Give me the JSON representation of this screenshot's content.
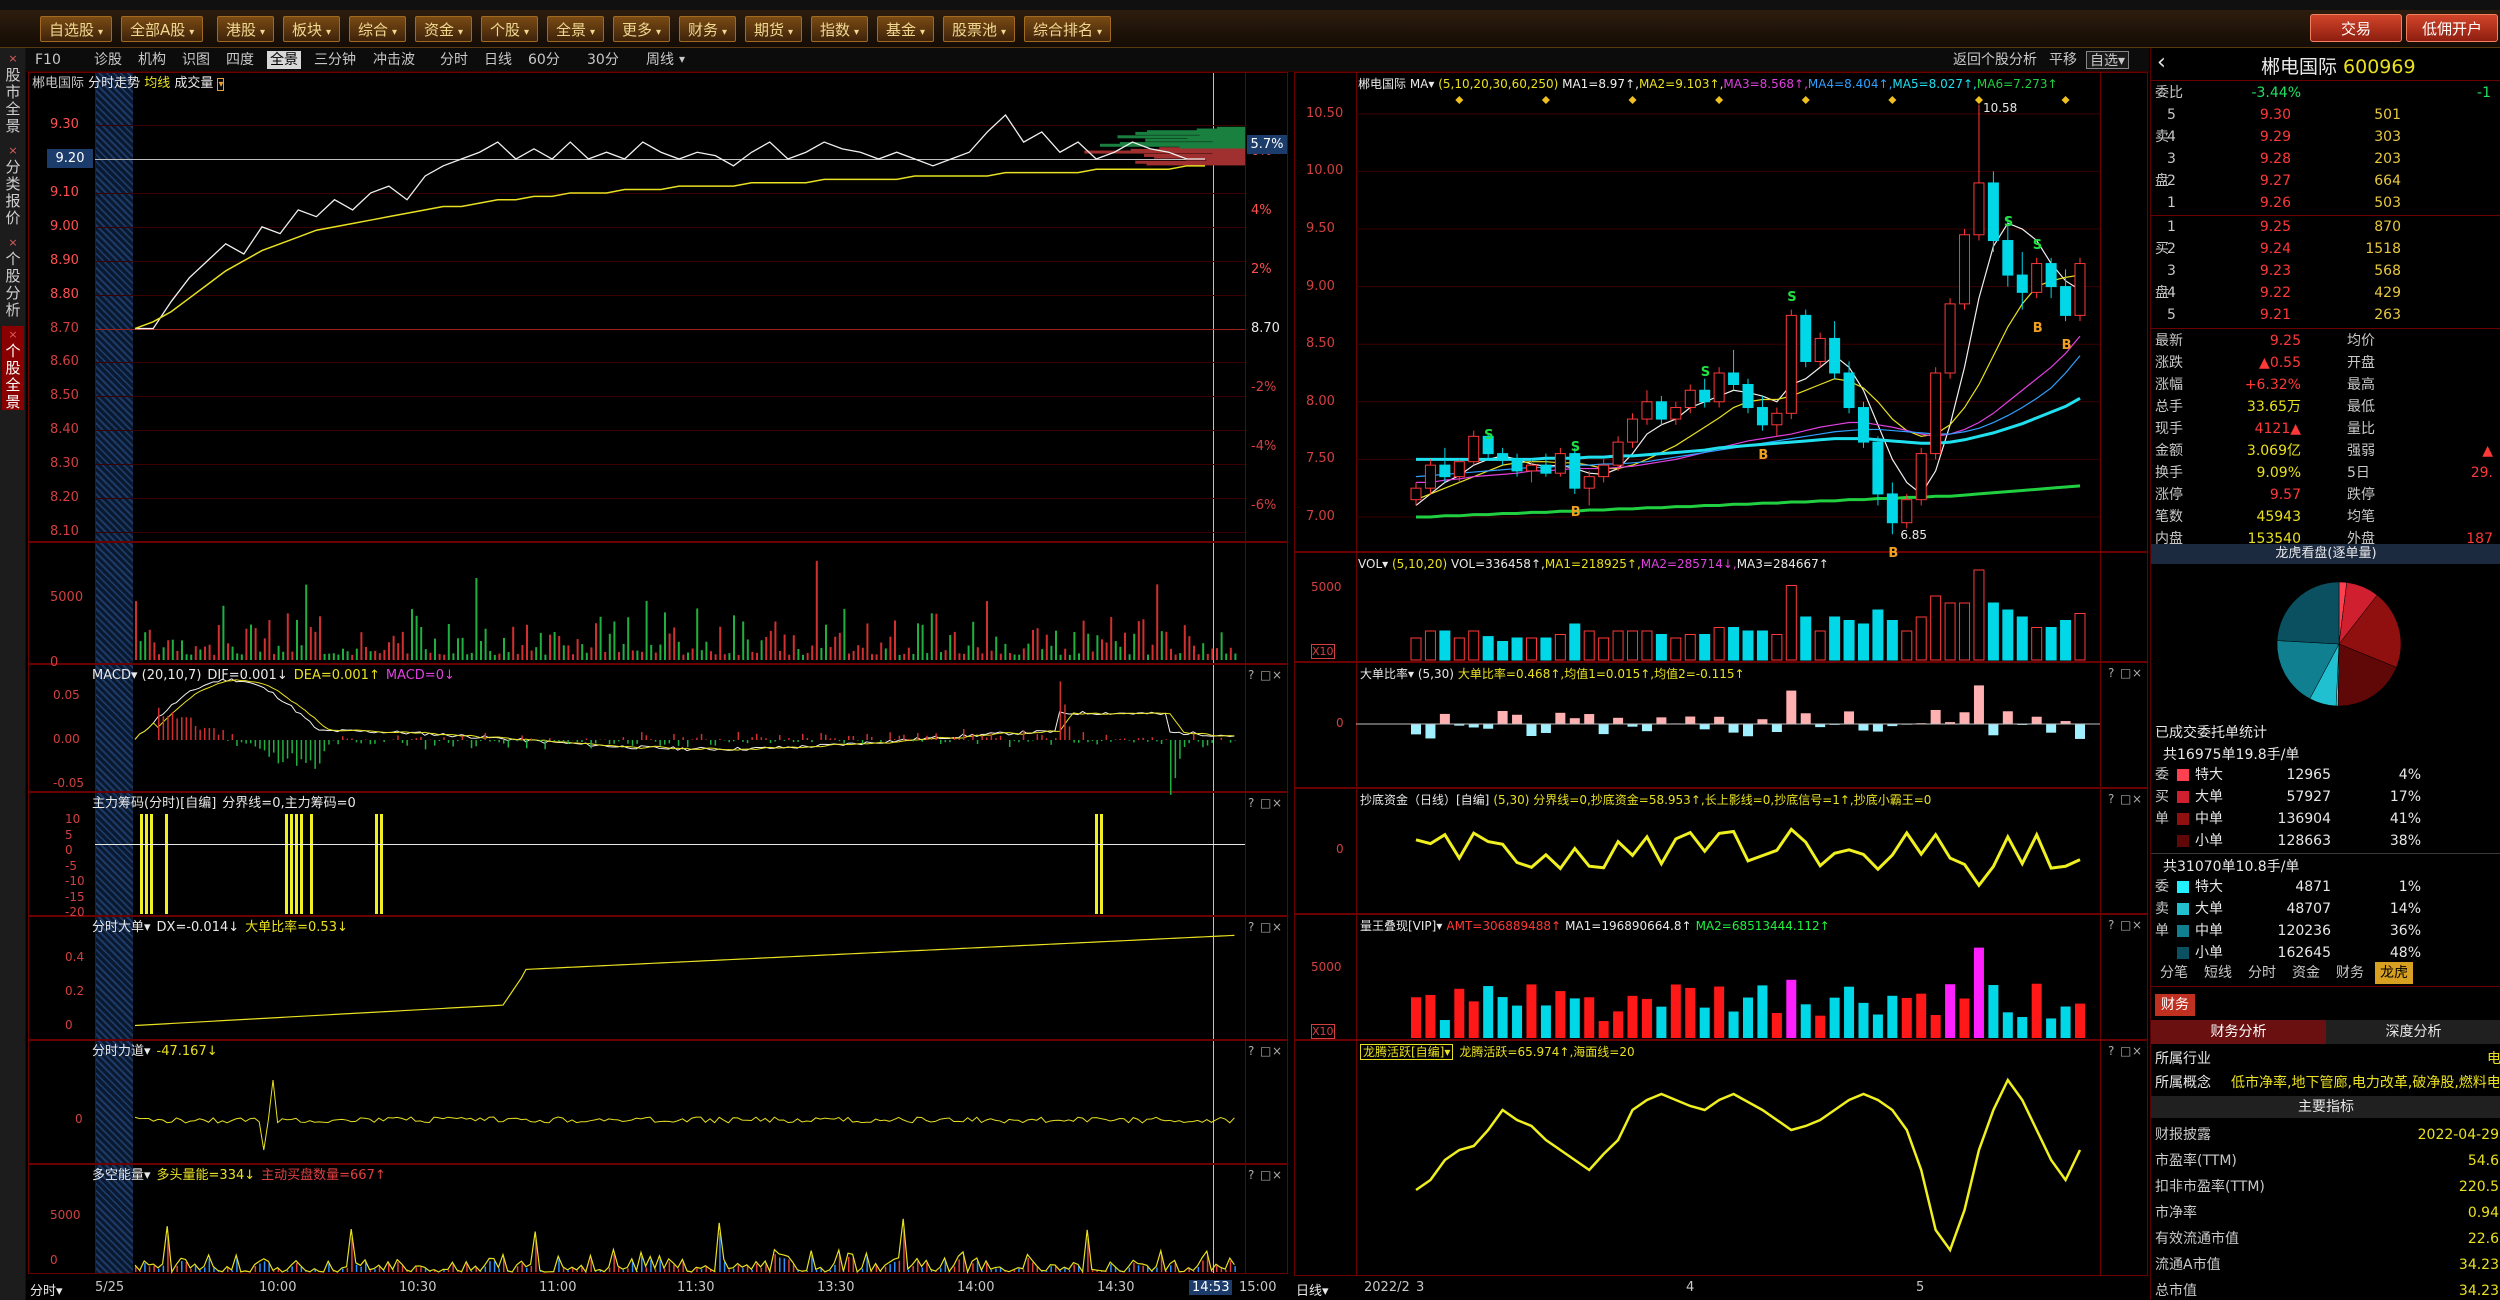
{
  "topmenu": {
    "items": [
      "自选股",
      "全部A股",
      "港股",
      "板块",
      "综合",
      "资金",
      "个股",
      "全景",
      "更多",
      "财务",
      "期货",
      "指数",
      "基金",
      "股票池",
      "综合排名"
    ],
    "trade_btn": "交易",
    "open_btn": "低佣开户"
  },
  "leftnav": [
    {
      "label": "股市全景",
      "active": false
    },
    {
      "label": "分类报价",
      "active": false
    },
    {
      "label": "个股分析",
      "active": false
    },
    {
      "label": "个股全景",
      "active": true
    }
  ],
  "toolbar": {
    "items": [
      "F10",
      "诊股",
      "机构",
      "识图",
      "四度",
      "全景",
      "三分钟",
      "冲击波",
      "分时",
      "日线",
      "60分",
      "30分",
      "周线"
    ],
    "active": "全景",
    "back_label": "返回个股分析",
    "flat_label": "平移",
    "selfsel_label": "自选"
  },
  "colors": {
    "up": "#ff3838",
    "down": "#00d8e8",
    "line_yellow": "#e8e020",
    "grid_red": "#6a0000",
    "label_white": "#e8e8e8"
  },
  "intraday": {
    "stock": "郴电国际",
    "title": "分时走势",
    "avg_label": "均线",
    "vol_label": "成交量",
    "prices": [
      "9.30",
      "9.20",
      "9.10",
      "9.00",
      "8.90",
      "8.80",
      "8.70",
      "8.60",
      "8.50",
      "8.40",
      "8.30",
      "8.20",
      "8.10"
    ],
    "pcts": [
      "6%",
      "4%",
      "2%",
      "-2%",
      "-4%",
      "-6%"
    ],
    "current_price": "9.20",
    "current_pct": "5.7%",
    "base_price": "8.70",
    "price_series": [
      8.7,
      8.7,
      8.78,
      8.85,
      8.9,
      8.95,
      8.92,
      9.0,
      8.98,
      9.05,
      9.03,
      9.08,
      9.05,
      9.1,
      9.12,
      9.08,
      9.15,
      9.18,
      9.2,
      9.22,
      9.25,
      9.2,
      9.23,
      9.2,
      9.25,
      9.2,
      9.22,
      9.2,
      9.25,
      9.22,
      9.2,
      9.22,
      9.21,
      9.18,
      9.22,
      9.25,
      9.2,
      9.22,
      9.25,
      9.23,
      9.22,
      9.2,
      9.22,
      9.2,
      9.18,
      9.2,
      9.22,
      9.28,
      9.33,
      9.25,
      9.28,
      9.22,
      9.25,
      9.2,
      9.22,
      9.25,
      9.23,
      9.22,
      9.2,
      9.2
    ],
    "avg_series": [
      8.7,
      8.72,
      8.75,
      8.79,
      8.83,
      8.87,
      8.9,
      8.93,
      8.95,
      8.97,
      8.99,
      9.0,
      9.01,
      9.02,
      9.03,
      9.04,
      9.05,
      9.06,
      9.06,
      9.07,
      9.08,
      9.08,
      9.09,
      9.09,
      9.1,
      9.1,
      9.1,
      9.11,
      9.11,
      9.11,
      9.12,
      9.12,
      9.12,
      9.12,
      9.13,
      9.13,
      9.13,
      9.13,
      9.14,
      9.14,
      9.14,
      9.14,
      9.14,
      9.15,
      9.15,
      9.15,
      9.15,
      9.15,
      9.16,
      9.16,
      9.16,
      9.16,
      9.16,
      9.17,
      9.17,
      9.17,
      9.17,
      9.17,
      9.18,
      9.18
    ],
    "price_range": [
      8.1,
      9.38
    ]
  },
  "vol_axis": [
    "5000",
    "0"
  ],
  "macd": {
    "title": "MACD",
    "params": "(20,10,7)",
    "dif": "DIF=0.001↓",
    "dea": "DEA=0.001↑",
    "macd": "MACD=0↓",
    "axis": [
      "0.05",
      "0.00",
      "-0.05"
    ]
  },
  "zljc": {
    "title": "主力筹码(分时)",
    "tag": "[自编]",
    "text": "分界线=0,主力筹码=0",
    "axis": [
      "10",
      "5",
      "0",
      "-5",
      "-10",
      "-15",
      "-20"
    ]
  },
  "fsdd": {
    "title": "分时大单",
    "text1": "DX=-0.014↓",
    "text2": "大单比率=0.53↓",
    "axis": [
      "0.4",
      "0.2",
      "0"
    ]
  },
  "fsld": {
    "title": "分时力道",
    "text1": "-47.167↓",
    "axis": [
      "0"
    ]
  },
  "dknl": {
    "title": "多空能量",
    "text1": "多头量能=334↓",
    "text2": "主动买盘数量=667↑",
    "axis": [
      "5000",
      "0"
    ]
  },
  "time_axis": {
    "label": "分时",
    "items": [
      "5/25",
      "10:00",
      "10:30",
      "11:00",
      "11:30",
      "13:30",
      "14:00",
      "14:30",
      "14:53",
      "15:00"
    ]
  },
  "kline": {
    "stock": "郴电国际",
    "ma_label": "MA",
    "params": "(5,10,20,30,60,250)",
    "ma1": "MA1=8.97↑",
    "ma2": "MA2=9.103↑",
    "ma3": "MA3=8.568↑",
    "ma4": "MA4=8.404↑",
    "ma5": "MA5=8.027↑",
    "ma6": "MA6=7.273↑",
    "axis": [
      "10.50",
      "10.00",
      "9.50",
      "9.00",
      "8.50",
      "8.00",
      "7.50",
      "7.00"
    ],
    "high_label": "10.58",
    "low_label": "6.85",
    "range": [
      6.8,
      10.62
    ],
    "ohlc": [
      [
        7.15,
        7.3,
        7.1,
        7.25
      ],
      [
        7.25,
        7.5,
        7.2,
        7.45
      ],
      [
        7.45,
        7.6,
        7.3,
        7.35
      ],
      [
        7.35,
        7.5,
        7.3,
        7.48
      ],
      [
        7.48,
        7.75,
        7.45,
        7.7
      ],
      [
        7.7,
        7.72,
        7.5,
        7.55
      ],
      [
        7.55,
        7.6,
        7.45,
        7.5
      ],
      [
        7.5,
        7.55,
        7.35,
        7.4
      ],
      [
        7.4,
        7.5,
        7.3,
        7.45
      ],
      [
        7.45,
        7.55,
        7.35,
        7.38
      ],
      [
        7.38,
        7.6,
        7.35,
        7.55
      ],
      [
        7.55,
        7.6,
        7.2,
        7.25
      ],
      [
        7.25,
        7.4,
        7.1,
        7.35
      ],
      [
        7.35,
        7.5,
        7.3,
        7.45
      ],
      [
        7.45,
        7.7,
        7.4,
        7.65
      ],
      [
        7.65,
        7.9,
        7.6,
        7.85
      ],
      [
        7.85,
        8.1,
        7.8,
        8.0
      ],
      [
        8.0,
        8.05,
        7.8,
        7.85
      ],
      [
        7.85,
        8.0,
        7.8,
        7.95
      ],
      [
        7.95,
        8.15,
        7.9,
        8.1
      ],
      [
        8.1,
        8.2,
        7.95,
        8.0
      ],
      [
        8.0,
        8.3,
        7.95,
        8.25
      ],
      [
        8.25,
        8.45,
        8.1,
        8.15
      ],
      [
        8.15,
        8.2,
        7.9,
        7.95
      ],
      [
        7.95,
        8.05,
        7.75,
        7.8
      ],
      [
        7.8,
        7.95,
        7.7,
        7.9
      ],
      [
        7.9,
        8.8,
        7.85,
        8.75
      ],
      [
        8.75,
        8.8,
        8.3,
        8.35
      ],
      [
        8.35,
        8.6,
        8.3,
        8.55
      ],
      [
        8.55,
        8.7,
        8.2,
        8.25
      ],
      [
        8.25,
        8.35,
        7.9,
        7.95
      ],
      [
        7.95,
        8.0,
        7.6,
        7.65
      ],
      [
        7.65,
        7.7,
        7.1,
        7.2
      ],
      [
        7.2,
        7.3,
        6.85,
        6.95
      ],
      [
        6.95,
        7.2,
        6.9,
        7.15
      ],
      [
        7.15,
        7.6,
        7.1,
        7.55
      ],
      [
        7.55,
        8.3,
        7.5,
        8.25
      ],
      [
        8.25,
        8.9,
        8.2,
        8.85
      ],
      [
        8.85,
        9.5,
        8.8,
        9.45
      ],
      [
        9.45,
        10.58,
        9.4,
        9.9
      ],
      [
        9.9,
        10.0,
        9.3,
        9.4
      ],
      [
        9.4,
        9.6,
        9.0,
        9.1
      ],
      [
        9.1,
        9.3,
        8.8,
        8.95
      ],
      [
        8.95,
        9.25,
        8.9,
        9.2
      ],
      [
        9.2,
        9.25,
        8.9,
        9.0
      ],
      [
        9.0,
        9.15,
        8.7,
        8.75
      ],
      [
        8.75,
        9.25,
        8.7,
        9.2
      ]
    ],
    "ma_series": [
      {
        "color": "#f0f0f0",
        "values": [
          7.1,
          7.2,
          7.3,
          7.36,
          7.45,
          7.5,
          7.53,
          7.5,
          7.46,
          7.44,
          7.45,
          7.42,
          7.38,
          7.37,
          7.42,
          7.55,
          7.72,
          7.8,
          7.85,
          7.95,
          8.0,
          8.05,
          8.1,
          8.08,
          8.05,
          8.0,
          8.15,
          8.2,
          8.3,
          8.4,
          8.3,
          8.1,
          7.8,
          7.5,
          7.3,
          7.2,
          7.4,
          7.8,
          8.3,
          8.9,
          9.35,
          9.55,
          9.5,
          9.4,
          9.2,
          9.05,
          8.97
        ]
      },
      {
        "color": "#e8e020",
        "values": [
          7.15,
          7.2,
          7.25,
          7.3,
          7.35,
          7.4,
          7.45,
          7.47,
          7.48,
          7.48,
          7.47,
          7.47,
          7.45,
          7.42,
          7.42,
          7.45,
          7.5,
          7.56,
          7.62,
          7.7,
          7.78,
          7.86,
          7.95,
          8.0,
          8.02,
          8.02,
          8.05,
          8.1,
          8.15,
          8.2,
          8.18,
          8.12,
          8.0,
          7.85,
          7.75,
          7.7,
          7.72,
          7.8,
          7.95,
          8.15,
          8.4,
          8.65,
          8.85,
          9.0,
          9.05,
          9.08,
          9.1
        ]
      },
      {
        "color": "#e040e0",
        "values": [
          7.3,
          7.3,
          7.32,
          7.33,
          7.35,
          7.36,
          7.37,
          7.38,
          7.4,
          7.4,
          7.41,
          7.42,
          7.42,
          7.42,
          7.43,
          7.44,
          7.46,
          7.48,
          7.5,
          7.53,
          7.56,
          7.6,
          7.63,
          7.66,
          7.68,
          7.7,
          7.72,
          7.75,
          7.78,
          7.8,
          7.82,
          7.82,
          7.8,
          7.78,
          7.75,
          7.72,
          7.7,
          7.72,
          7.76,
          7.82,
          7.9,
          8.0,
          8.1,
          8.2,
          8.3,
          8.42,
          8.57
        ]
      },
      {
        "color": "#30a0ff",
        "values": [
          7.35,
          7.36,
          7.37,
          7.38,
          7.39,
          7.4,
          7.41,
          7.42,
          7.43,
          7.43,
          7.44,
          7.45,
          7.45,
          7.46,
          7.46,
          7.47,
          7.48,
          7.5,
          7.52,
          7.54,
          7.56,
          7.58,
          7.6,
          7.62,
          7.64,
          7.66,
          7.68,
          7.7,
          7.72,
          7.74,
          7.75,
          7.76,
          7.76,
          7.75,
          7.74,
          7.73,
          7.72,
          7.72,
          7.74,
          7.77,
          7.82,
          7.88,
          7.95,
          8.03,
          8.12,
          8.25,
          8.4
        ]
      },
      {
        "color": "#20e0f0",
        "values": [
          7.5,
          7.5,
          7.5,
          7.5,
          7.5,
          7.5,
          7.5,
          7.5,
          7.5,
          7.51,
          7.51,
          7.51,
          7.52,
          7.52,
          7.53,
          7.53,
          7.54,
          7.55,
          7.56,
          7.57,
          7.58,
          7.6,
          7.61,
          7.62,
          7.63,
          7.64,
          7.65,
          7.66,
          7.67,
          7.68,
          7.68,
          7.68,
          7.67,
          7.66,
          7.65,
          7.64,
          7.64,
          7.65,
          7.67,
          7.7,
          7.73,
          7.77,
          7.81,
          7.86,
          7.91,
          7.96,
          8.03
        ]
      },
      {
        "color": "#20d040",
        "values": [
          7.0,
          7.0,
          7.01,
          7.01,
          7.02,
          7.02,
          7.03,
          7.03,
          7.04,
          7.04,
          7.05,
          7.05,
          7.06,
          7.06,
          7.07,
          7.07,
          7.08,
          7.08,
          7.09,
          7.09,
          7.1,
          7.1,
          7.11,
          7.11,
          7.12,
          7.12,
          7.13,
          7.13,
          7.14,
          7.14,
          7.15,
          7.15,
          7.16,
          7.16,
          7.17,
          7.17,
          7.18,
          7.18,
          7.19,
          7.2,
          7.21,
          7.22,
          7.23,
          7.24,
          7.25,
          7.26,
          7.27
        ]
      }
    ]
  },
  "kvol": {
    "title": "VOL",
    "params": "(5,10,20)",
    "vol": "VOL=336458↑",
    "ma1": "MA1=218925↑",
    "ma2": "MA2=285714↓",
    "ma3": "MA3=284667↑",
    "axis": [
      "5000",
      "0"
    ],
    "unit_label": "X10"
  },
  "ddbl": {
    "title": "大单比率",
    "params": "(5,30)",
    "text": "大单比率=0.468↑,均值1=0.015↑,均值2=-0.115↑",
    "axis": [
      "0"
    ]
  },
  "cdzj": {
    "title": "抄底资金（日线）",
    "tag": "[自编]",
    "params": "(5,30)",
    "text": "分界线=0,抄底资金=58.953↑,长上影线=0,抄底信号=1↑,抄底小霸王=0",
    "axis": [
      "0"
    ]
  },
  "lwdx": {
    "title": "量王叠现[VIP]",
    "amt": "AMT=306889488↑",
    "ma1": "MA1=196890664.8↑",
    "ma2": "MA2=68513444.112↑",
    "axis": [
      "5000",
      "0"
    ],
    "unit_label": "X10"
  },
  "ltyh": {
    "title": "龙腾活跃[自编]",
    "text1": "龙腾活跃=65.974↑",
    "text2": "海面线=20"
  },
  "k_time_axis": {
    "label": "日线",
    "items": [
      "2022/2",
      "3",
      "4",
      "5"
    ]
  },
  "quote": {
    "name": "郴电国际",
    "code": "600969",
    "ratio_label": "委比",
    "ratio": "-3.44%",
    "ratio_right": "-1",
    "asks": [
      {
        "lvl": "5",
        "price": "9.30",
        "vol": "501"
      },
      {
        "lvl": "4",
        "price": "9.29",
        "vol": "303"
      },
      {
        "lvl": "3",
        "price": "9.28",
        "vol": "203"
      },
      {
        "lvl": "2",
        "price": "9.27",
        "vol": "664"
      },
      {
        "lvl": "1",
        "price": "9.26",
        "vol": "503"
      }
    ],
    "bids": [
      {
        "lvl": "1",
        "price": "9.25",
        "vol": "870"
      },
      {
        "lvl": "2",
        "price": "9.24",
        "vol": "1518"
      },
      {
        "lvl": "3",
        "price": "9.23",
        "vol": "568"
      },
      {
        "lvl": "4",
        "price": "9.22",
        "vol": "429"
      },
      {
        "lvl": "5",
        "price": "9.21",
        "vol": "263"
      }
    ],
    "sell_side": "卖",
    "buy_side": "买",
    "pan": "盘",
    "stats": [
      {
        "l": "最新",
        "v": "9.25",
        "l2": "均价",
        "v2": ""
      },
      {
        "l": "涨跌",
        "v": "▲0.55",
        "l2": "开盘",
        "v2": ""
      },
      {
        "l": "涨幅",
        "v": "+6.32%",
        "l2": "最高",
        "v2": ""
      },
      {
        "l": "总手",
        "v": "33.65万",
        "l2": "最低",
        "v2": ""
      },
      {
        "l": "现手",
        "v": "4121▲",
        "l2": "量比",
        "v2": ""
      },
      {
        "l": "金额",
        "v": "3.069亿",
        "l2": "强弱",
        "v2": "▲"
      },
      {
        "l": "换手",
        "v": "9.09%",
        "l2": "5日",
        "v2": "29."
      },
      {
        "l": "涨停",
        "v": "9.57",
        "l2": "跌停",
        "v2": ""
      },
      {
        "l": "笔数",
        "v": "45943",
        "l2": "均笔",
        "v2": ""
      },
      {
        "l": "内盘",
        "v": "153540",
        "l2": "外盘",
        "v2": "187"
      }
    ],
    "pie_title": "龙虎看盘(逐单量)",
    "pie_values": [
      4,
      17,
      41,
      38,
      1,
      14,
      36,
      48
    ],
    "order_stat_title": "已成交委托单统计",
    "buy_summary": "共16975单19.8手/单",
    "sell_summary": "共31070单10.8手/单",
    "buy_sides": [
      "委",
      "买",
      "单"
    ],
    "sell_sides": [
      "委",
      "卖",
      "单"
    ],
    "buy_rows": [
      {
        "label": "特大",
        "v": "12965",
        "p": "4%",
        "c": "#ff4050"
      },
      {
        "label": "大单",
        "v": "57927",
        "p": "17%",
        "c": "#d02030"
      },
      {
        "label": "中单",
        "v": "136904",
        "p": "41%",
        "c": "#901010"
      },
      {
        "label": "小单",
        "v": "128663",
        "p": "38%",
        "c": "#600808"
      }
    ],
    "sell_rows": [
      {
        "label": "特大",
        "v": "4871",
        "p": "1%",
        "c": "#20f0ff"
      },
      {
        "label": "大单",
        "v": "48707",
        "p": "14%",
        "c": "#20c0d0"
      },
      {
        "label": "中单",
        "v": "120236",
        "p": "36%",
        "c": "#108090"
      },
      {
        "label": "小单",
        "v": "162645",
        "p": "48%",
        "c": "#0a5060"
      }
    ],
    "bottom_tabs": [
      "分笔",
      "短线",
      "分时",
      "资金",
      "财务",
      "龙虎"
    ],
    "bottom_active": "龙虎",
    "fin_tab": "财务",
    "fin_analysis": "财务分析",
    "depth_analysis": "深度分析",
    "industry_label": "所属行业",
    "industry_value": "电",
    "concept_label": "所属概念",
    "concept_value": "低市净率,地下管廊,电力改革,破净股,燃料电池",
    "main_index": "主要指标",
    "fin_rows": [
      {
        "l": "财报披露",
        "v": "2022-04-29"
      },
      {
        "l": "市盈率(TTM)",
        "v": "54.6"
      },
      {
        "l": "扣非市盈率(TTM)",
        "v": "220.5"
      },
      {
        "l": "市净率",
        "v": "0.94"
      },
      {
        "l": "有效流通市值",
        "v": "22.6"
      },
      {
        "l": "流通A市值",
        "v": "34.23"
      },
      {
        "l": "总市值",
        "v": "34.23"
      }
    ]
  }
}
